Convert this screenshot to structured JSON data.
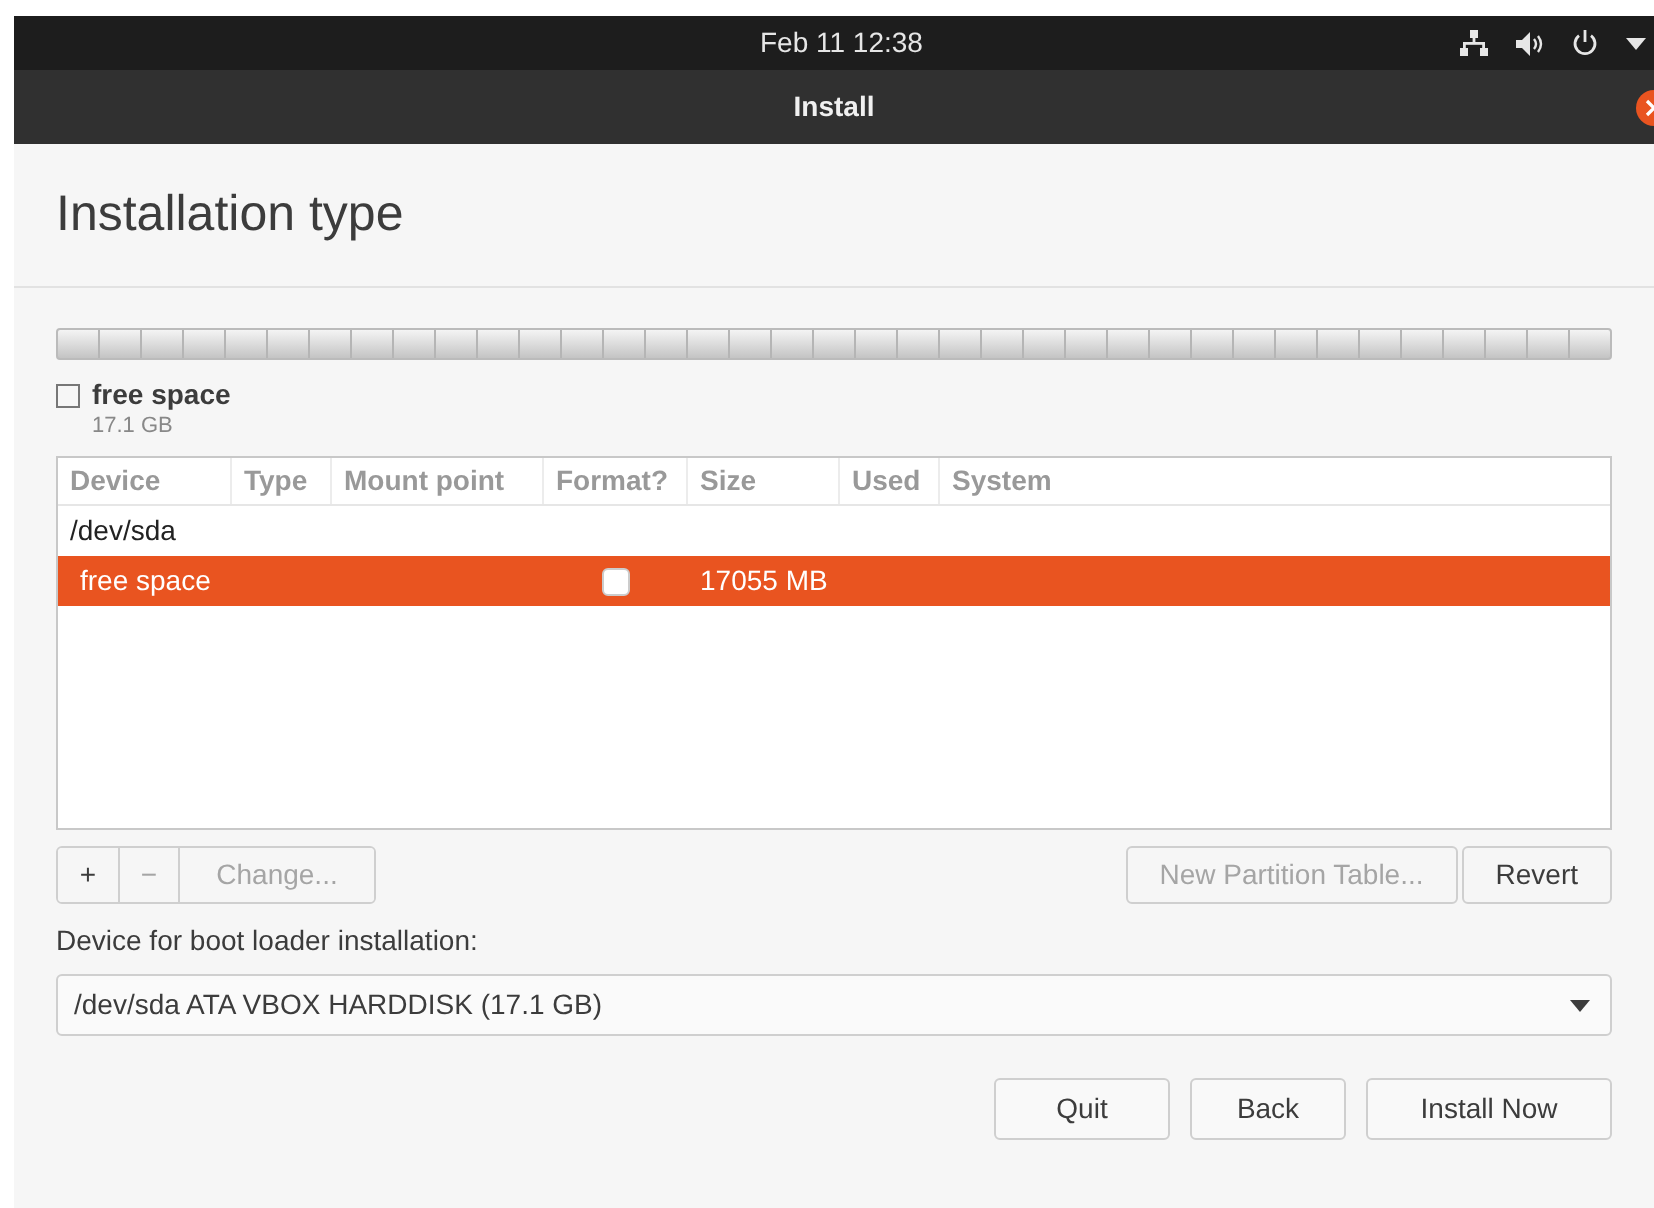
{
  "top_bar": {
    "clock": "Feb 11  12:38"
  },
  "window": {
    "title": "Install"
  },
  "heading": "Installation type",
  "legend": {
    "label": "free space",
    "size": "17.1 GB",
    "checked": false
  },
  "table": {
    "columns": [
      "Device",
      "Type",
      "Mount point",
      "Format?",
      "Size",
      "Used",
      "System"
    ],
    "rows": [
      {
        "device": "/dev/sda",
        "selected": false,
        "children": [
          {
            "device": "free space",
            "format_checked": false,
            "size": "17055 MB",
            "selected": true
          }
        ]
      }
    ]
  },
  "edit_buttons": [
    {
      "label": "+",
      "disabled": false
    },
    {
      "label": "−",
      "disabled": true
    },
    {
      "label": "Change...",
      "disabled": true
    }
  ],
  "table_buttons": [
    {
      "label": "New Partition Table...",
      "disabled": true
    },
    {
      "label": "Revert",
      "disabled": false
    }
  ],
  "boot_loader": {
    "label": "Device for boot loader installation:",
    "value": "/dev/sda ATA VBOX HARDDISK (17.1 GB)"
  },
  "buttons": [
    "Quit",
    "Back",
    "Install Now"
  ]
}
